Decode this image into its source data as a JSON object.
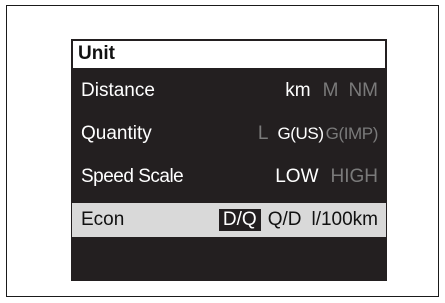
{
  "panel": {
    "title": "Unit",
    "distance": {
      "label": "Distance",
      "options": [
        "km",
        "M",
        "NM"
      ],
      "selected": "km"
    },
    "quantity": {
      "label": "Quantity",
      "options": [
        "L",
        "G(US)",
        "G(IMP)"
      ],
      "selected": "G(US)"
    },
    "speed_scale": {
      "label": "Speed Scale",
      "options": [
        "LOW",
        "HIGH"
      ],
      "selected": "LOW"
    },
    "econ": {
      "label": "Econ",
      "options": [
        "D/Q",
        "Q/D",
        "l/100km"
      ],
      "selected": "D/Q"
    }
  },
  "colors": {
    "panel_background": "#231f20",
    "highlight_row": "#d9d9d9",
    "inactive_option": "#7a7a7a",
    "active_option": "#ffffff"
  }
}
